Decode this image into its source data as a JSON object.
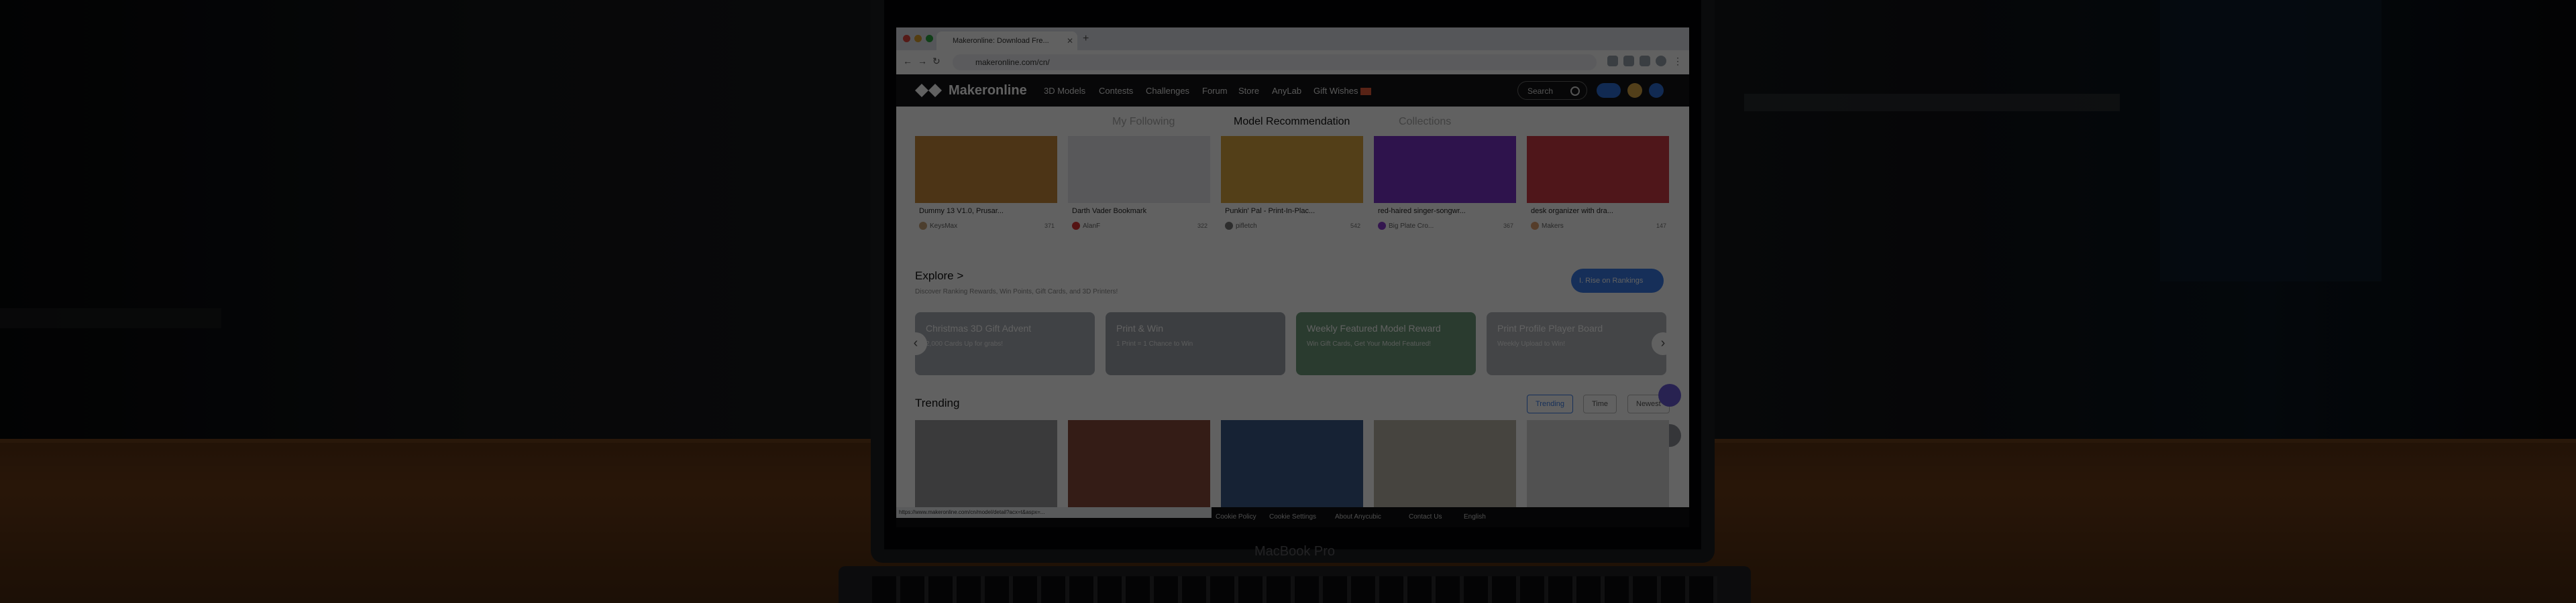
{
  "browser": {
    "tab_title": "Makeronline: Download Fre...",
    "url": "makeronline.com/cn/"
  },
  "site": {
    "logo_text": "Makeronline",
    "nav": [
      "3D Models",
      "Contests",
      "Challenges",
      "Forum",
      "Store",
      "AnyLab",
      "Gift Wishes"
    ],
    "search_placeholder": "Search"
  },
  "feed_tabs": [
    {
      "label": "My Following",
      "active": false
    },
    {
      "label": "Model Recommendation",
      "active": true
    },
    {
      "label": "Collections",
      "active": false
    }
  ],
  "cards": [
    {
      "title": "Dummy 13 V1.0, Prusar...",
      "author": "KeysMax",
      "stats": "371",
      "thumb_color": "#c9883a"
    },
    {
      "title": "Darth Vader Bookmark",
      "author": "AlanF",
      "stats": "322",
      "thumb_color": "#e8e8ec"
    },
    {
      "title": "Punkin' Pal - Print-In-Plac...",
      "author": "pifletch",
      "stats": "542",
      "thumb_color": "#d9a640"
    },
    {
      "title": "red-haired singer-songwr...",
      "author": "Big Plate Cro...",
      "stats": "367",
      "thumb_color": "#7a32c8"
    },
    {
      "title": "desk organizer with dra...",
      "author": "Makers",
      "stats": "147",
      "thumb_color": "#d03a44"
    }
  ],
  "explore": {
    "title": "Explore >",
    "subtitle": "Discover Ranking Rewards, Win Points, Gift Cards, and 3D Printers!",
    "rank_button": "I. Rise on Rankings",
    "promos": [
      {
        "title": "Christmas 3D Gift Advent",
        "subtitle": "2,000 Cards Up for grabs!",
        "color": "#a8adb5"
      },
      {
        "title": "Print & Win",
        "subtitle": "1 Print = 1 Chance to Win",
        "color": "#9ea3aa"
      },
      {
        "title": "Weekly Featured Model Reward",
        "subtitle": "Win Gift Cards, Get Your Model Featured!",
        "color": "#6f9c7c"
      },
      {
        "title": "Print Profile Player Board",
        "subtitle": "Weekly Upload to Win!",
        "color": "#b3b6bc"
      }
    ]
  },
  "trending": {
    "title": "Trending",
    "filters": [
      {
        "label": "Trending",
        "active": true
      },
      {
        "label": "Time",
        "active": false
      },
      {
        "label": "Newest",
        "active": false
      }
    ],
    "thumb_colors": [
      "#9a9a9c",
      "#8a4a3a",
      "#3a5a8a",
      "#b9b2a6",
      "#d6d6d6"
    ]
  },
  "footer": {
    "status_url": "https://www.makeronline.com/cn/model/detail?acx=t&aspx=...",
    "links": [
      "Cookie Policy",
      "Cookie Settings",
      "About Anycubic",
      "Contact Us",
      "English"
    ]
  },
  "device": {
    "brand": "MacBook Pro"
  }
}
